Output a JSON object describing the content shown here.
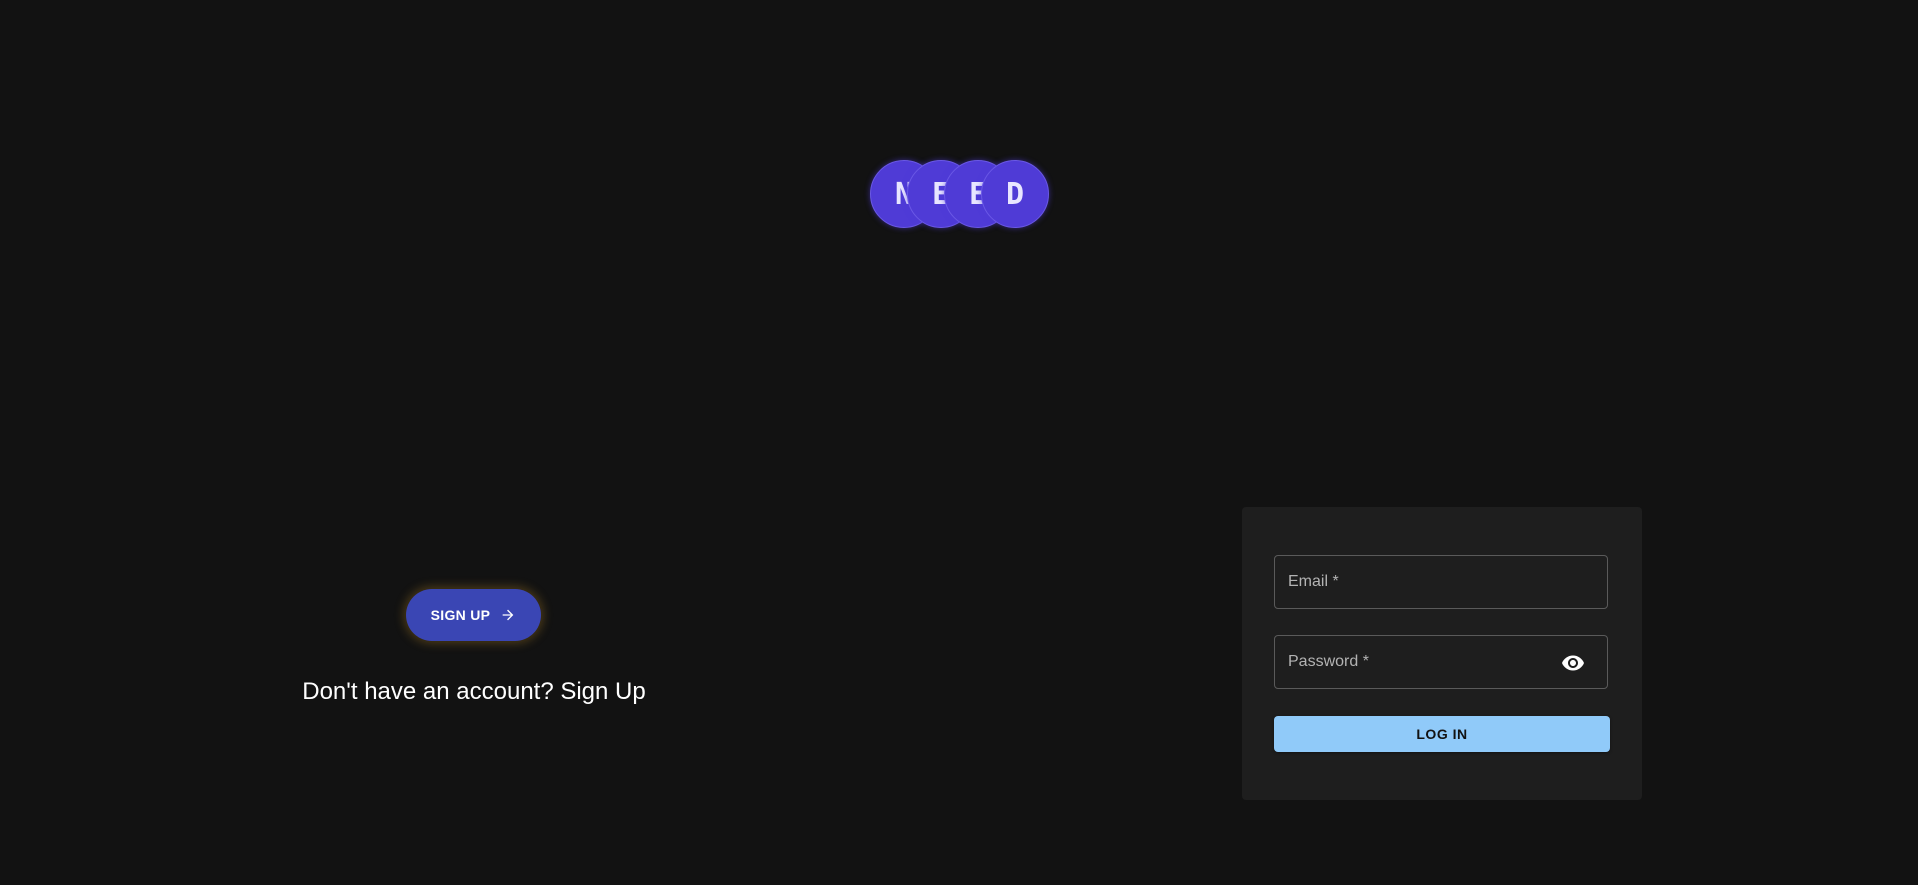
{
  "logo": {
    "letters": [
      "N",
      "E",
      "E",
      "D"
    ],
    "color": "#4f3bd6"
  },
  "signup": {
    "button_label": "SIGN UP",
    "button_icon": "arrow-right-icon",
    "prompt": "Don't have an account? Sign Up"
  },
  "login": {
    "email_label": "Email *",
    "email_value": "",
    "password_label": "Password *",
    "password_value": "",
    "password_toggle_icon": "eye-icon",
    "button_label": "LOG IN",
    "button_color": "#90caf9"
  },
  "theme": {
    "background": "#121212",
    "card_background": "#1e1e1e",
    "accent": "#3a46b4"
  }
}
